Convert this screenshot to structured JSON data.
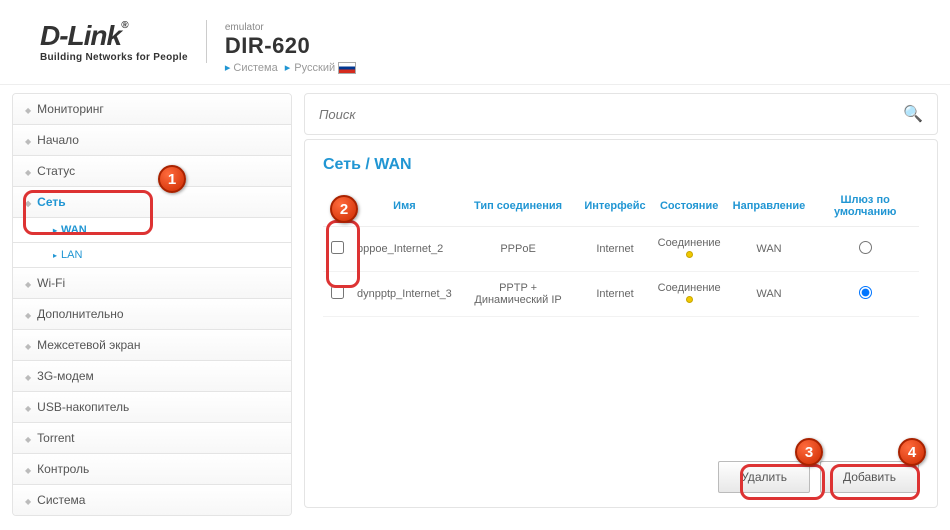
{
  "header": {
    "logo": "D-Link",
    "reg": "®",
    "logo_subtitle": "Building Networks for People",
    "emulator": "emulator",
    "model": "DIR-620",
    "crumb1": "Система",
    "crumb2": "Русский"
  },
  "sidebar": {
    "items": [
      "Мониторинг",
      "Начало",
      "Статус",
      "Сеть",
      "Wi-Fi",
      "Дополнительно",
      "Межсетевой экран",
      "3G-модем",
      "USB-накопитель",
      "Torrent",
      "Контроль",
      "Система"
    ],
    "sub": [
      "WAN",
      "LAN"
    ]
  },
  "search": {
    "placeholder": "Поиск"
  },
  "breadcrumb": "Сеть /  WAN",
  "table": {
    "headers": [
      "",
      "Имя",
      "Тип соединения",
      "Интерфейс",
      "Состояние",
      "Направление",
      "Шлюз по умолчанию"
    ],
    "rows": [
      {
        "name": "pppoe_Internet_2",
        "type": "PPPoE",
        "iface": "Internet",
        "state": "Соединение",
        "dir": "WAN",
        "gw": false
      },
      {
        "name": "dynpptp_Internet_3",
        "type": "PPTP + Динамический IP",
        "iface": "Internet",
        "state": "Соединение",
        "dir": "WAN",
        "gw": true
      }
    ]
  },
  "buttons": {
    "delete": "Удалить",
    "add": "Добавить"
  },
  "callouts": {
    "b1": "1",
    "b2": "2",
    "b3": "3",
    "b4": "4"
  }
}
